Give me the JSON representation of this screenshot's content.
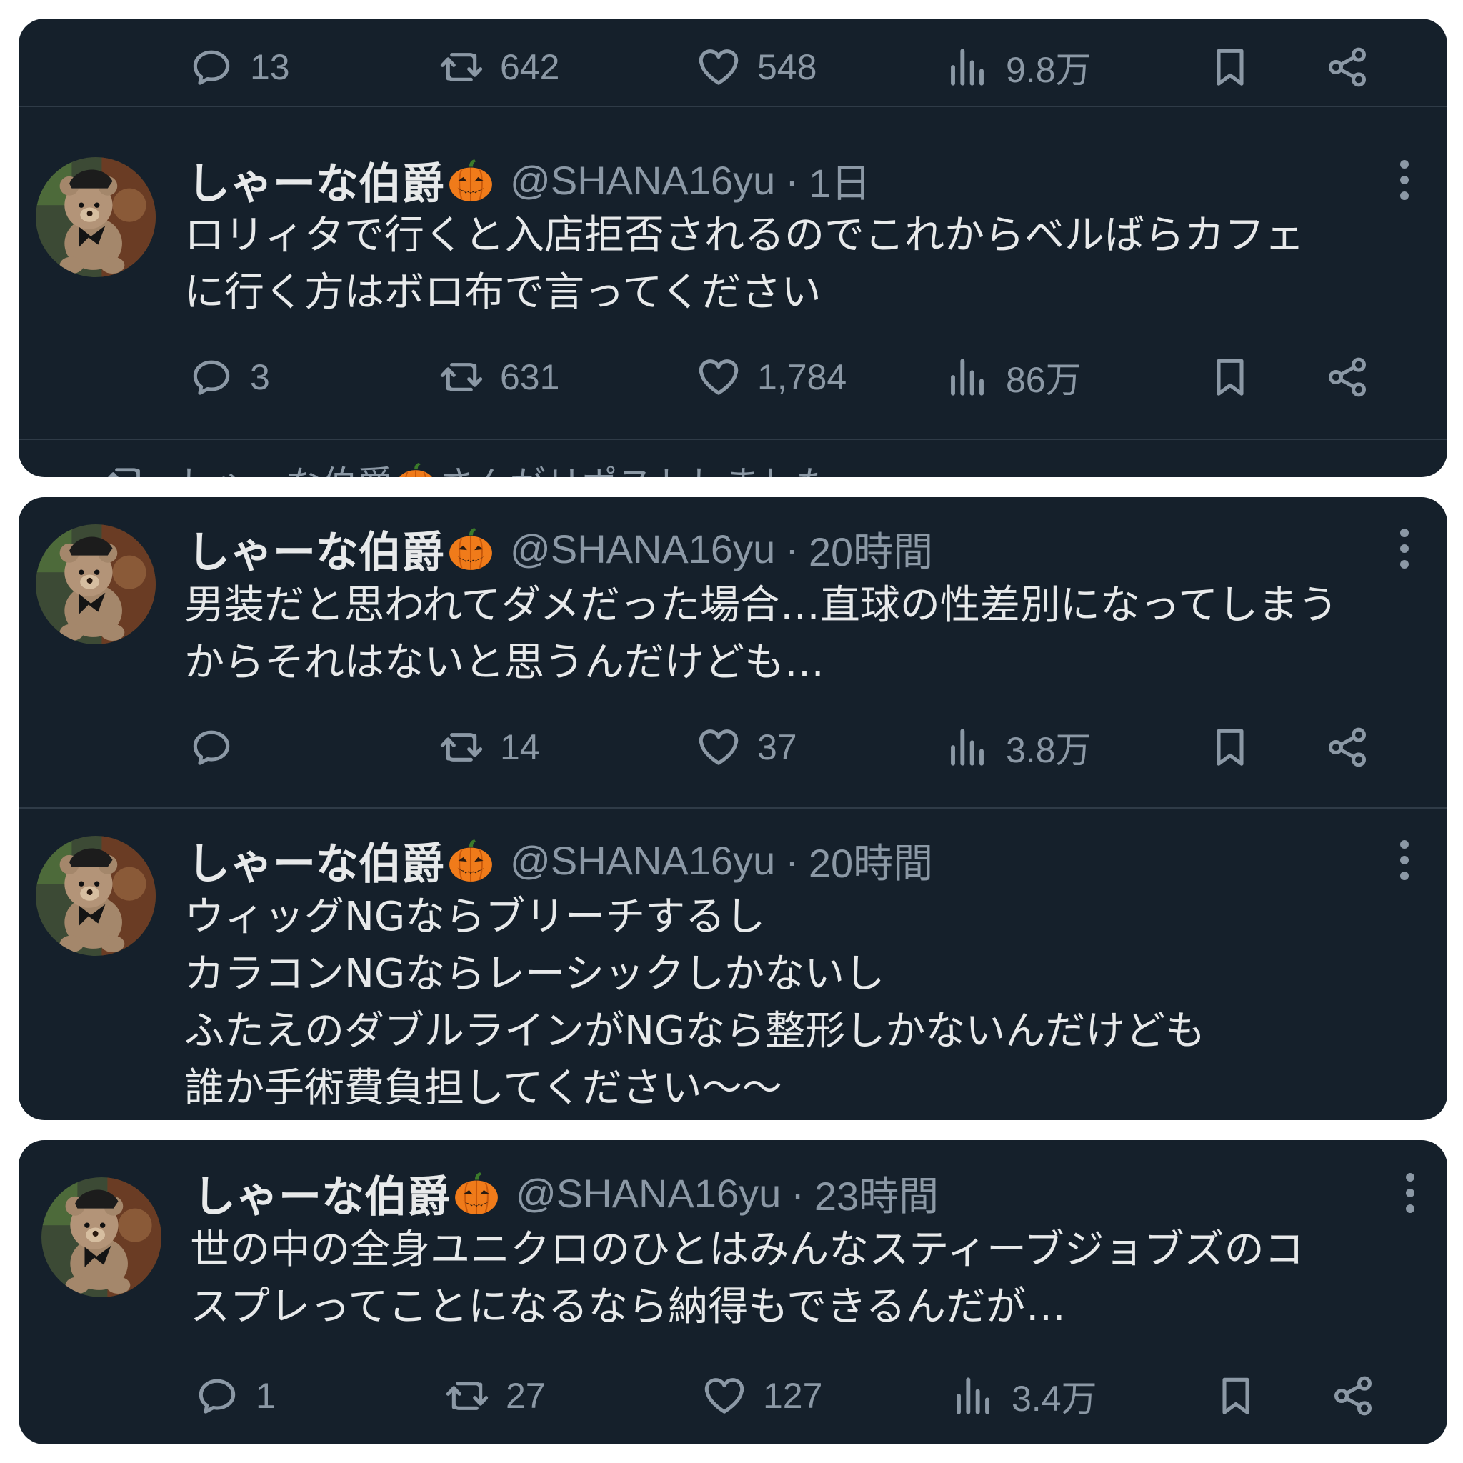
{
  "user": {
    "name": "しゃーな伯爵",
    "handle": "@SHANA16yu",
    "separator": "·"
  },
  "panel1": {
    "top_actions": {
      "reply": "13",
      "repost": "642",
      "like": "548",
      "views": "9.8万"
    },
    "tweet": {
      "time": "1日",
      "text": "ロリィタで行くと入店拒否されるのでこれからベルばらカフェ\nに行く方はボロ布で言ってください",
      "actions": {
        "reply": "3",
        "repost": "631",
        "like": "1,784",
        "views": "86万"
      }
    },
    "repost_notice": {
      "name": "しゃーな伯爵",
      "suffix": "さんがリポストしました"
    }
  },
  "panel2": {
    "tweet1": {
      "time": "20時間",
      "text": "男装だと思われてダメだった場合…直球の性差別になってしまう\nからそれはないと思うんだけども…",
      "actions": {
        "reply": "",
        "repost": "14",
        "like": "37",
        "views": "3.8万"
      }
    },
    "tweet2": {
      "time": "20時間",
      "text": "ウィッグNGならブリーチするし\nカラコンNGならレーシックしかないし\nふたえのダブルラインがNGなら整形しかないんだけども\n誰か手術費負担してください〜〜"
    }
  },
  "panel3": {
    "tweet": {
      "time": "23時間",
      "text": "世の中の全身ユニクロのひとはみんなスティーブジョブズのコ\nスプレってことになるなら納得もできるんだが…",
      "actions": {
        "reply": "1",
        "repost": "27",
        "like": "127",
        "views": "3.4万"
      }
    }
  },
  "icons": {
    "reply": "reply-icon",
    "repost": "repost-icon",
    "like": "like-icon",
    "views": "views-icon",
    "bookmark": "bookmark-icon",
    "share": "share-icon",
    "more": "more-icon",
    "emoji": "pumpkin-emoji"
  },
  "colors": {
    "background": "#15202b",
    "text": "#e7e9ea",
    "muted": "#8b98a5",
    "divider": "#2f3b47",
    "pumpkin": "#f07b1a"
  }
}
